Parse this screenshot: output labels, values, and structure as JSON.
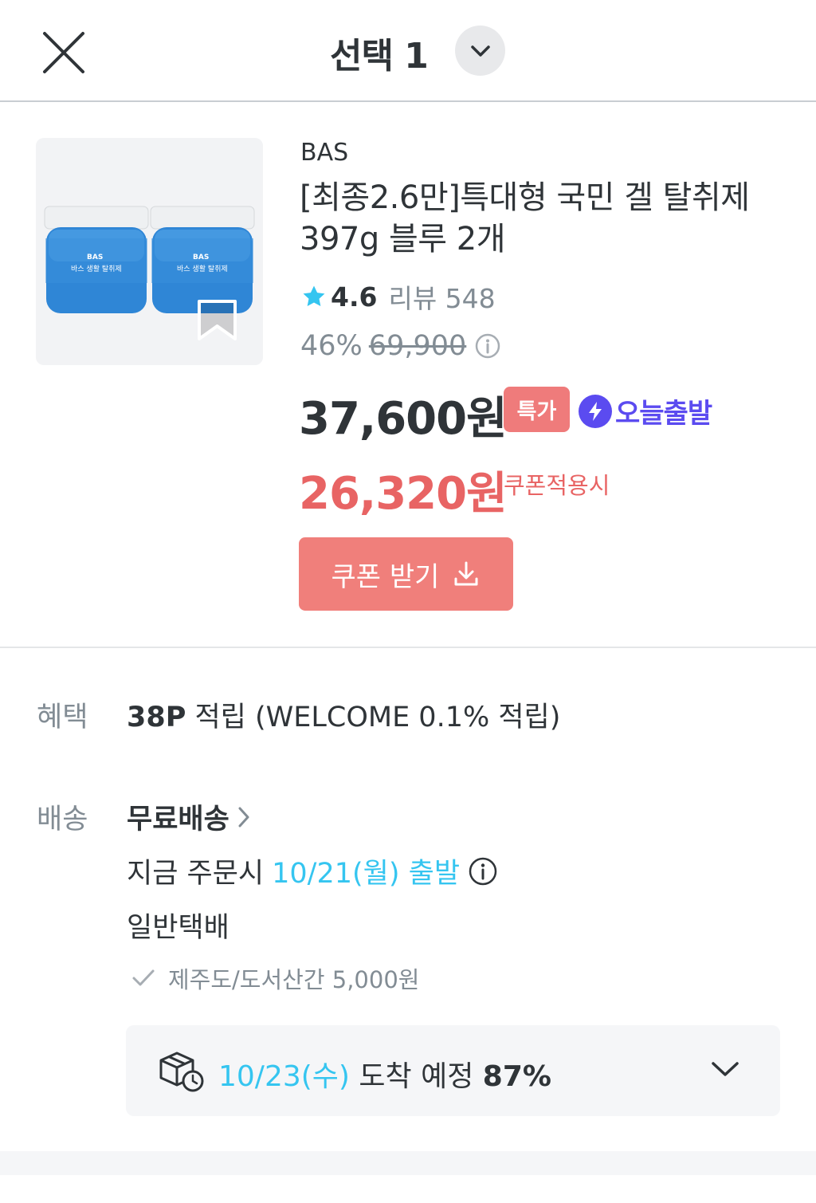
{
  "header": {
    "close_icon": "close-icon",
    "title": "선택 1",
    "dropdown_icon": "chevron-down-icon"
  },
  "product": {
    "image_label_brand": "BAS",
    "image_label_name": "바스 생활 탈취제",
    "bookmark_icon": "bookmark-icon",
    "brand": "BAS",
    "name": "[최종2.6만]특대형 국민 겔 탈취제 397g 블루 2개",
    "rating": "4.6",
    "review_label": "리뷰 548",
    "discount": "46%",
    "original_price": "69,900",
    "price": "37,600원",
    "sale_badge": "특가",
    "today_label": "오늘출발",
    "coupon_price": "26,320원",
    "coupon_note": "쿠폰적용시",
    "coupon_button": "쿠폰 받기",
    "colors": {
      "accent": "#35c5f0",
      "sale": "#ef7b7b",
      "coupon_text": "#e86464",
      "today": "#5b4bf0"
    }
  },
  "benefit": {
    "label": "혜택",
    "points": "38P",
    "text": " 적립 (WELCOME 0.1% 적립)"
  },
  "shipping": {
    "label": "배송",
    "free_label": "무료배송",
    "order_prefix": "지금 주문시",
    "depart_date": "10/21(월) 출발",
    "type": "일반택배",
    "extra": "제주도/도서산간 5,000원",
    "arrival_date": "10/23(수)",
    "arrival_text": " 도착 예정 ",
    "arrival_pct": "87%"
  }
}
